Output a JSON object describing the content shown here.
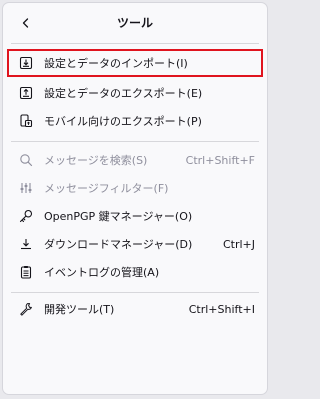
{
  "header": {
    "title": "ツール"
  },
  "menu": {
    "import_settings": "設定とデータのインポート(I)",
    "export_settings": "設定とデータのエクスポート(E)",
    "mobile_export": "モバイル向けのエクスポート(P)",
    "message_search": "メッセージを検索(S)",
    "message_search_shortcut": "Ctrl+Shift+F",
    "message_filters": "メッセージフィルター(F)",
    "openpgp_key_manager": "OpenPGP 鍵マネージャー(O)",
    "download_manager": "ダウンロードマネージャー(D)",
    "download_manager_shortcut": "Ctrl+J",
    "activity_manager": "イベントログの管理(A)",
    "dev_tools": "開発ツール(T)",
    "dev_tools_shortcut": "Ctrl+Shift+I"
  },
  "colors": {
    "highlight_border": "#e0141e",
    "disabled_text": "#8f8f9d"
  },
  "icons": {
    "back": "chevron-left-icon",
    "import": "import-tray-icon",
    "export": "export-tray-icon",
    "mobile_export": "mobile-export-icon",
    "search": "search-icon",
    "filter": "sliders-icon",
    "key": "key-icon",
    "download": "download-icon",
    "log": "clipboard-list-icon",
    "dev_tools": "wrench-icon"
  }
}
